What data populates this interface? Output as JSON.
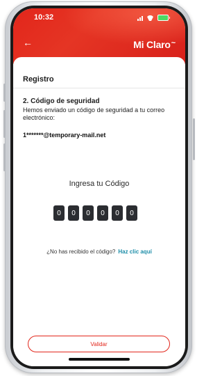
{
  "status": {
    "time": "10:32"
  },
  "header": {
    "brand": "Mi Claro"
  },
  "page": {
    "title": "Registro",
    "section_title": "2. Código de seguridad",
    "description": "Hemos enviado un código de seguridad a tu correo electrónico:",
    "email": "1*******@temporary-mail.net",
    "code_prompt": "Ingresa tu Código",
    "code_digits": [
      "0",
      "0",
      "0",
      "0",
      "0",
      "0"
    ],
    "resend_question": "¿No has recibido el código?",
    "resend_link": "Haz clic aquí",
    "validate_button": "Validar"
  },
  "colors": {
    "brand_red": "#e2261b",
    "link": "#1c8da8"
  }
}
